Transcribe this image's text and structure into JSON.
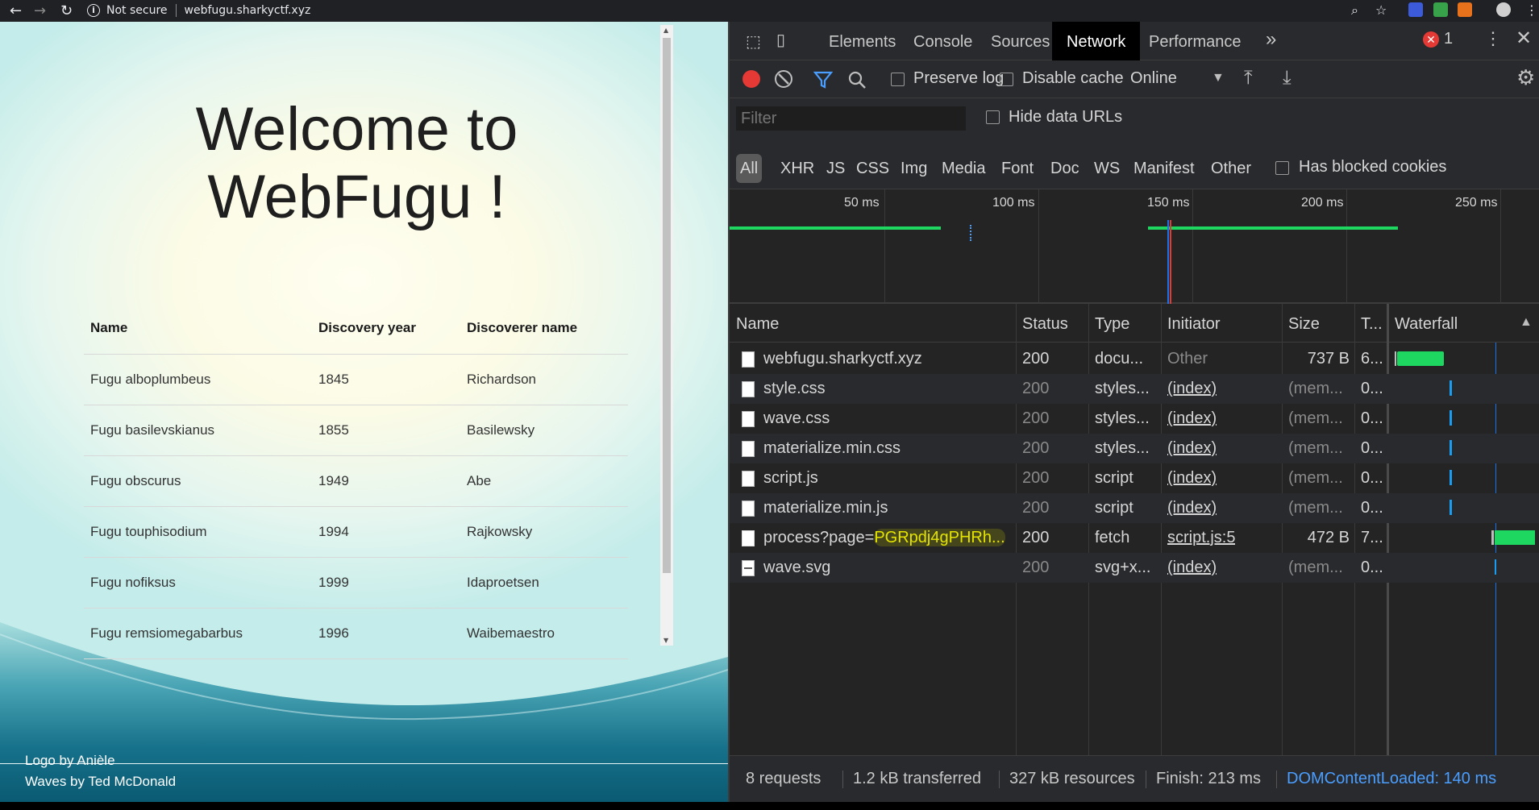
{
  "browser": {
    "security_label": "Not secure",
    "url": "webfugu.sharkyctf.xyz"
  },
  "page": {
    "title_line1": "Welcome to",
    "title_line2": "WebFugu !",
    "table": {
      "headers": [
        "Name",
        "Discovery year",
        "Discoverer name"
      ],
      "rows": [
        [
          "Fugu alboplumbeus",
          "1845",
          "Richardson"
        ],
        [
          "Fugu basilevskianus",
          "1855",
          "Basilewsky"
        ],
        [
          "Fugu obscurus",
          "1949",
          "Abe"
        ],
        [
          "Fugu touphisodium",
          "1994",
          "Rajkowsky"
        ],
        [
          "Fugu nofiksus",
          "1999",
          "Idaproetsen"
        ],
        [
          "Fugu remsiomegabarbus",
          "1996",
          "Waibemaestro"
        ]
      ]
    },
    "credits": [
      "Logo by Anièle",
      "Waves by Ted McDonald"
    ],
    "colors": {
      "wave_light": "#a8dede",
      "wave_dark": "#0a5a72"
    }
  },
  "devtools": {
    "tabs": [
      "Elements",
      "Console",
      "Sources",
      "Network",
      "Performance"
    ],
    "active_tab": "Network",
    "more_tabs": "»",
    "error_count": "1",
    "toolbar": {
      "preserve_log": "Preserve log",
      "disable_cache": "Disable cache",
      "throttle": "Online"
    },
    "filter": {
      "placeholder": "Filter",
      "hide_data_urls": "Hide data URLs",
      "types": [
        "All",
        "XHR",
        "JS",
        "CSS",
        "Img",
        "Media",
        "Font",
        "Doc",
        "WS",
        "Manifest",
        "Other"
      ],
      "active_type": "All",
      "has_blocked_cookies": "Has blocked cookies"
    },
    "overview_ticks": [
      "50 ms",
      "100 ms",
      "150 ms",
      "200 ms",
      "250 ms"
    ],
    "columns": [
      "Name",
      "Status",
      "Type",
      "Initiator",
      "Size",
      "T...",
      "Waterfall"
    ],
    "requests": [
      {
        "name": "webfugu.sharkyctf.xyz",
        "status": "200",
        "type": "docu...",
        "initiator": "Other",
        "size": "737 B",
        "time": "6..."
      },
      {
        "name": "style.css",
        "status": "200",
        "type": "styles...",
        "initiator": "(index)",
        "size": "(mem...",
        "time": "0..."
      },
      {
        "name": "wave.css",
        "status": "200",
        "type": "styles...",
        "initiator": "(index)",
        "size": "(mem...",
        "time": "0..."
      },
      {
        "name": "materialize.min.css",
        "status": "200",
        "type": "styles...",
        "initiator": "(index)",
        "size": "(mem...",
        "time": "0..."
      },
      {
        "name": "script.js",
        "status": "200",
        "type": "script",
        "initiator": "(index)",
        "size": "(mem...",
        "time": "0..."
      },
      {
        "name": "materialize.min.js",
        "status": "200",
        "type": "script",
        "initiator": "(index)",
        "size": "(mem...",
        "time": "0..."
      },
      {
        "name_prefix": "process?page=",
        "name_highlight": "PGRpdj4gPHRh...",
        "status": "200",
        "type": "fetch",
        "initiator": "script.js:5",
        "size": "472 B",
        "time": "7..."
      },
      {
        "name": "wave.svg",
        "status": "200",
        "type": "svg+x...",
        "initiator": "(index)",
        "size": "(mem...",
        "time": "0..."
      }
    ],
    "status_bar": {
      "requests": "8 requests",
      "transferred": "1.2 kB transferred",
      "resources": "327 kB resources",
      "finish": "Finish: 213 ms",
      "dom_content_loaded": "DOMContentLoaded: 140 ms"
    },
    "colors": {
      "bar_green": "#1ed760",
      "dcl_blue": "#1a73e8",
      "highlight": "#e4e400"
    }
  }
}
